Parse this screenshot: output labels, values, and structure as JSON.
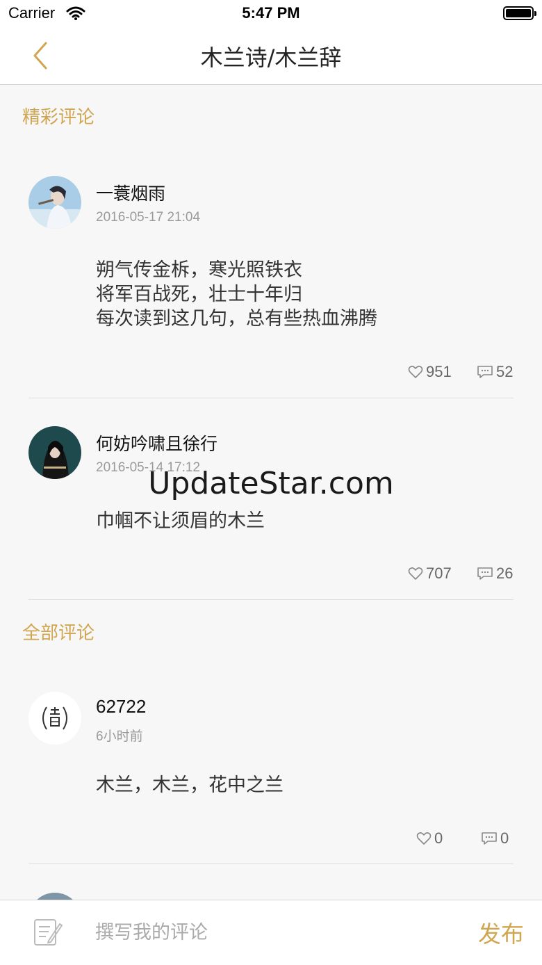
{
  "status_bar": {
    "carrier": "Carrier",
    "time": "5:47 PM"
  },
  "nav": {
    "title": "木兰诗/木兰辞"
  },
  "sections": {
    "featured": "精彩评论",
    "all": "全部评论"
  },
  "comments": [
    {
      "user": "一蓑烟雨",
      "date": "2016-05-17 21:04",
      "text": "朔气传金柝，寒光照铁衣\n将军百战死，壮士十年归\n每次读到这几句，总有些热血沸腾",
      "likes": "951",
      "replies": "52"
    },
    {
      "user": "何妨吟啸且徐行",
      "date": "2016-05-14 17:12",
      "text": "巾帼不让须眉的木兰",
      "likes": "707",
      "replies": "26"
    },
    {
      "user": "62722",
      "date": "6小时前",
      "text": "木兰，木兰，花中之兰",
      "likes": "0",
      "replies": "0"
    }
  ],
  "watermark": "UpdateStar.com",
  "composer": {
    "placeholder": "撰写我的评论",
    "publish": "发布"
  },
  "colors": {
    "accent": "#d0a650",
    "background": "#f7f7f7"
  },
  "icons": {
    "back": "chevron-left-icon",
    "like": "heart-outline-icon",
    "reply": "speech-bubble-icon",
    "compose": "note-pencil-icon"
  }
}
